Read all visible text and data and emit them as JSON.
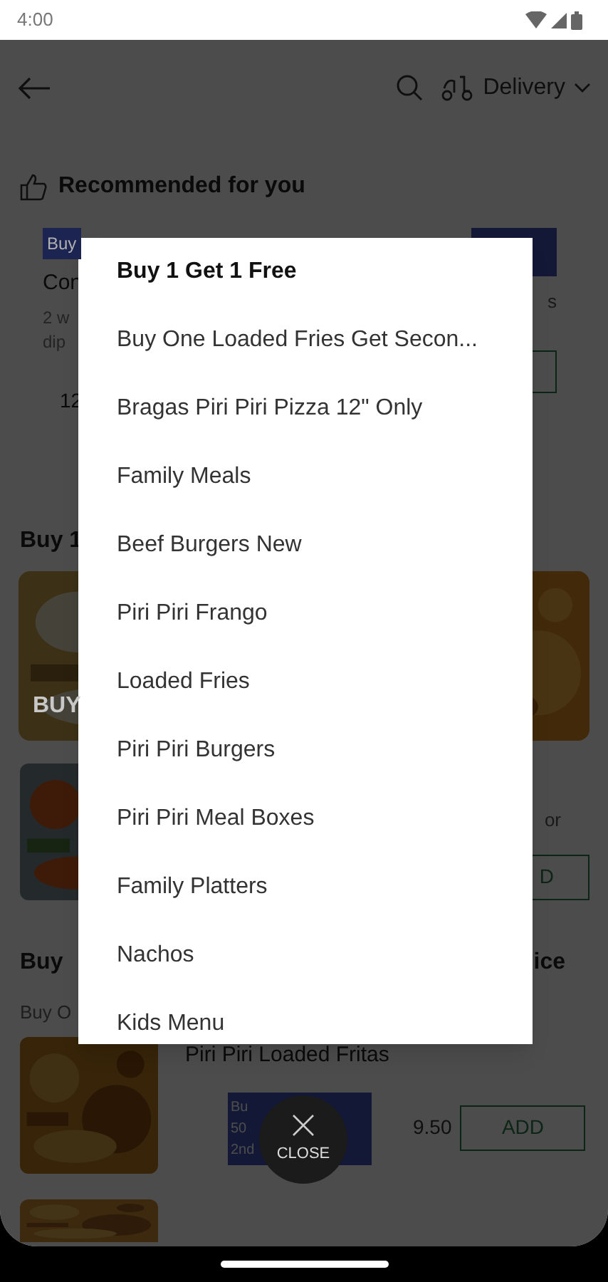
{
  "status_bar": {
    "time": "4:00"
  },
  "app_bar": {
    "order_mode": "Delivery"
  },
  "recommended": {
    "title": "Recommended for you",
    "card": {
      "badge": "Buy",
      "name": "Con",
      "description_lines": [
        "2 w",
        "dip"
      ],
      "price": "12"
    },
    "card_2": {
      "description": "s"
    }
  },
  "section_2": {
    "title": "Buy 1",
    "image_caption": "BUY",
    "item_description": "or",
    "add_button": "D"
  },
  "section_3": {
    "title_start": "Buy",
    "title_end": "ice",
    "subtitle": "Buy O",
    "item": {
      "name": "Piri Piri Loaded Fritas",
      "promo_lines": [
        "Bu",
        "50",
        "2nd"
      ],
      "price": "9.50",
      "add_button": "ADD"
    }
  },
  "category_menu": {
    "items": [
      {
        "label": "Buy 1 Get 1 Free",
        "selected": true
      },
      {
        "label": "Buy One Loaded Fries Get Secon...",
        "selected": false
      },
      {
        "label": "Bragas Piri Piri Pizza 12\" Only",
        "selected": false
      },
      {
        "label": "Family Meals",
        "selected": false
      },
      {
        "label": "Beef Burgers New",
        "selected": false
      },
      {
        "label": "Piri Piri Frango",
        "selected": false
      },
      {
        "label": "Loaded Fries",
        "selected": false
      },
      {
        "label": "Piri Piri Burgers",
        "selected": false
      },
      {
        "label": "Piri Piri Meal Boxes",
        "selected": false
      },
      {
        "label": "Family Platters",
        "selected": false
      },
      {
        "label": "Nachos",
        "selected": false
      },
      {
        "label": "Kids Menu",
        "selected": false
      }
    ]
  },
  "close_button": {
    "label": "CLOSE"
  }
}
